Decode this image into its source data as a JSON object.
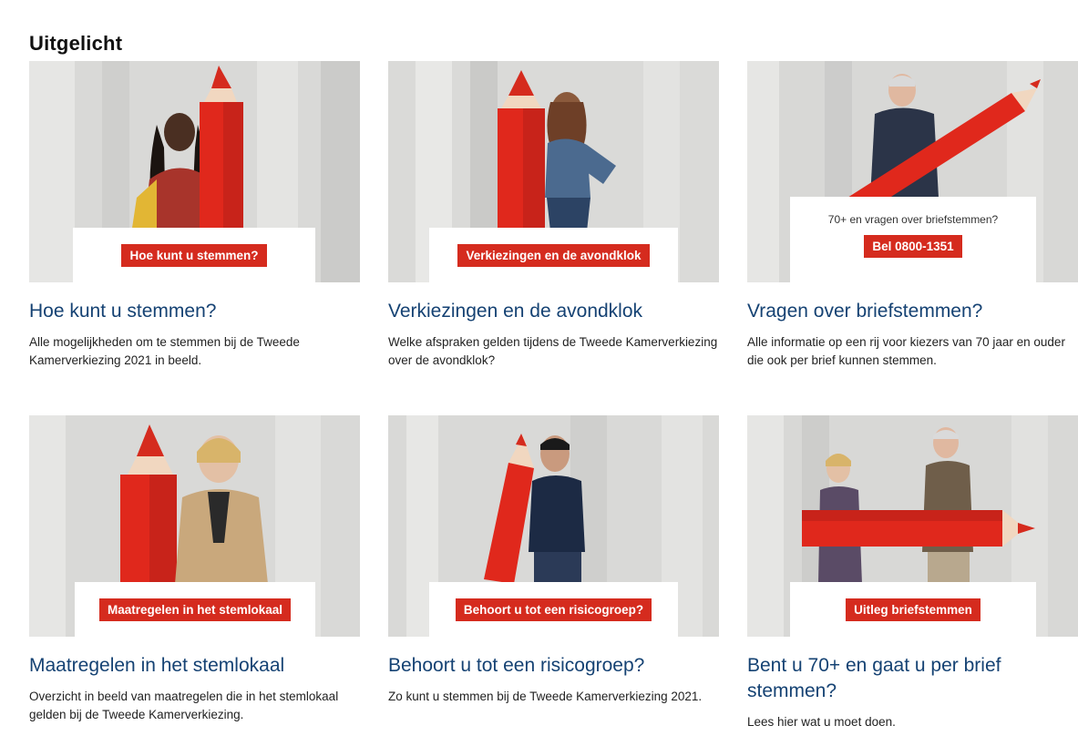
{
  "section": {
    "title": "Uitgelicht"
  },
  "cards": [
    {
      "tag": "Hoe kunt u stemmen?",
      "headline": "Hoe kunt u stemmen?",
      "description": "Alle mogelijkheden om te stemmen bij de Tweede Kamerverkiezing 2021 in beeld."
    },
    {
      "tag": "Verkiezingen en de avondklok",
      "headline": "Verkiezingen en de avondklok",
      "description": "Welke afspraken gelden tijdens de Tweede Kamerverkiezing over de avondklok?"
    },
    {
      "overlay_text": "70+ en vragen over briefstemmen?",
      "tag": "Bel 0800-1351",
      "headline": "Vragen over briefstemmen?",
      "description": "Alle informatie op een rij voor kiezers van 70 jaar en ouder die ook per brief kunnen stemmen."
    },
    {
      "tag": "Maatregelen in het stemlokaal",
      "headline": "Maatregelen in het stemlokaal",
      "description": "Overzicht in beeld van maatregelen die in het stemlokaal gelden bij de Tweede Kamerverkiezing."
    },
    {
      "tag": "Behoort u tot een risicogroep?",
      "headline": "Behoort u tot een risicogroep?",
      "description": "Zo kunt u stemmen bij de Tweede Kamerverkiezing 2021."
    },
    {
      "tag": "Uitleg briefstemmen",
      "headline": "Bent u 70+ en gaat u per brief stemmen?",
      "description": "Lees hier wat u moet doen."
    }
  ],
  "colors": {
    "tag_red": "#d52b1e",
    "link_blue": "#154273",
    "pencil_red": "#e0281c"
  }
}
